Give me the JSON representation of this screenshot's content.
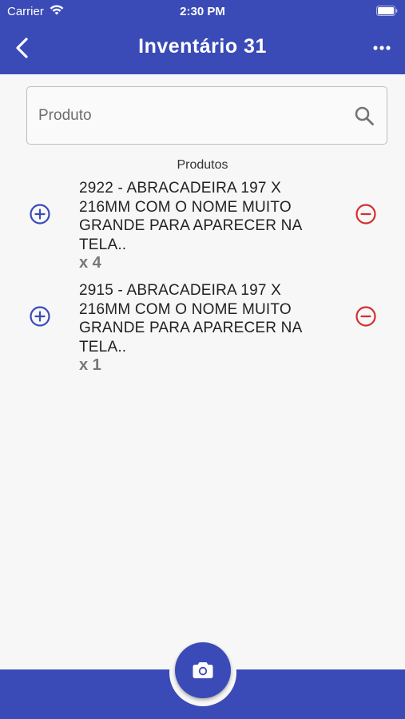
{
  "status_bar": {
    "carrier": "Carrier",
    "time": "2:30 PM"
  },
  "nav": {
    "title": "Inventário  31",
    "back_icon": "chevron-left-icon",
    "more_icon": "more-horizontal-icon"
  },
  "search": {
    "placeholder": "Produto",
    "value": "",
    "icon": "search-icon"
  },
  "section_label": "Produtos",
  "products": [
    {
      "name": "2922 - ABRACADEIRA 197 X 216MM COM O NOME MUITO GRANDE PARA APARECER NA TELA..",
      "quantity": "x 4"
    },
    {
      "name": "2915 - ABRACADEIRA 197 X 216MM COM O NOME MUITO GRANDE PARA APARECER NA TELA..",
      "quantity": "x 1"
    }
  ],
  "bottom": {
    "camera_icon": "camera-icon"
  },
  "colors": {
    "primary": "#3a4bb7",
    "add": "#3a4bb7",
    "remove": "#d32f2f",
    "background": "#f7f7f7"
  }
}
